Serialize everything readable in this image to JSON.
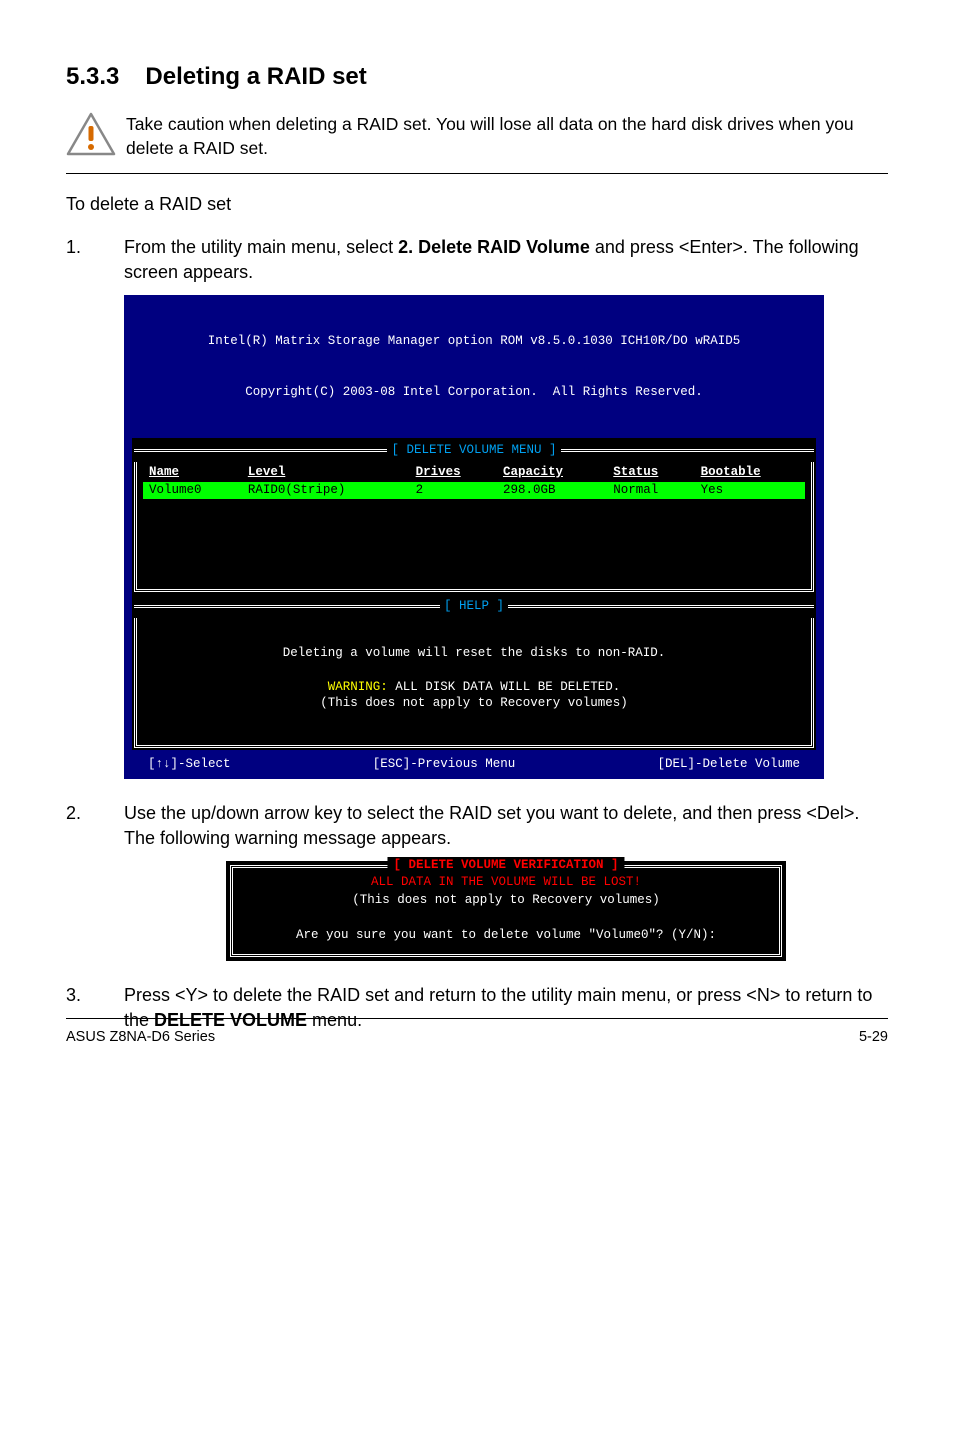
{
  "section": {
    "number": "5.3.3",
    "title": "Deleting a RAID set"
  },
  "caution": "Take caution when deleting a RAID set. You will lose all data on the hard disk drives when you delete a RAID set.",
  "subhead": "To delete a RAID set",
  "step1": {
    "num": "1.",
    "text_a": "From the utility main menu, select ",
    "bold": "2. Delete RAID Volume",
    "text_b": " and press <Enter>. The following screen appears."
  },
  "bios": {
    "header1": "Intel(R) Matrix Storage Manager option ROM v8.5.0.1030 ICH10R/DO wRAID5",
    "header2": "Copyright(C) 2003-08 Intel Corporation.  All Rights Reserved.",
    "delete_menu_label": "[ DELETE VOLUME MENU ]",
    "help_label": "[ HELP ]",
    "columns": {
      "name": "Name",
      "level": "Level",
      "drives": "Drives",
      "capacity": "Capacity",
      "status": "Status",
      "bootable": "Bootable"
    },
    "row": {
      "name": "Volume0",
      "level": "RAID0(Stripe)",
      "drives": "2",
      "capacity": "298.0GB",
      "status": "Normal",
      "bootable": "Yes"
    },
    "help1": "Deleting a volume will reset the disks to non-RAID.",
    "help_warn": "WARNING:",
    "help_warn_tail": " ALL DISK DATA WILL BE DELETED.",
    "help2": "(This does not apply to Recovery volumes)",
    "footer_select": "[↑↓]-Select",
    "footer_prev": "[ESC]-Previous Menu",
    "footer_del": "[DEL]-Delete Volume"
  },
  "step2": {
    "num": "2.",
    "text": "Use the up/down arrow key to select the RAID set you want to delete, and then press <Del>. The following warning message appears."
  },
  "verify": {
    "title": "[ DELETE VOLUME VERIFICATION ]",
    "l1": "ALL DATA IN THE VOLUME WILL BE LOST!",
    "l2": "(This does not apply to Recovery volumes)",
    "l3": "Are you sure you want to delete volume \"Volume0\"? (Y/N):"
  },
  "step3": {
    "num": "3.",
    "text_a": "Press <Y> to delete the RAID set and return to the utility main menu, or press <N> to return to the ",
    "bold": "DELETE VOLUME",
    "text_b": " menu."
  },
  "footer": {
    "product": "ASUS Z8NA-D6 Series",
    "page": "5-29"
  }
}
